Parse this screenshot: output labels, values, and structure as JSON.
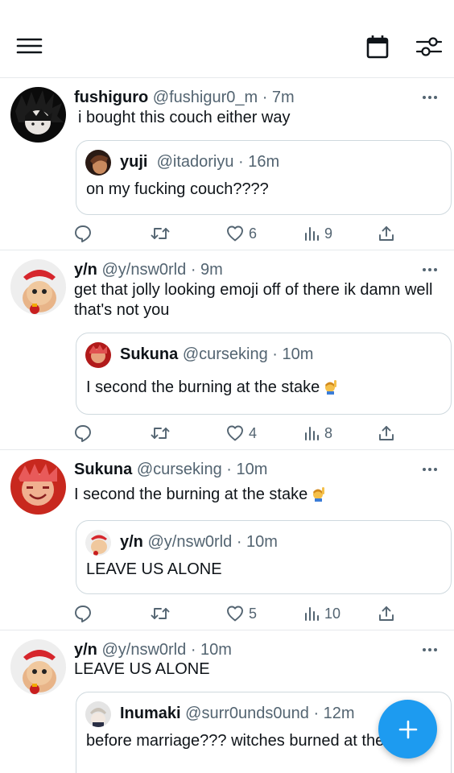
{
  "header": {
    "menu_icon": "hamburger-menu-icon",
    "calendar_icon": "calendar-icon",
    "filter_icon": "sliders-icon"
  },
  "colors": {
    "accent": "#1d9bf0",
    "text": "#0f1419",
    "muted": "#536471",
    "border": "#cfd9de"
  },
  "tweets": [
    {
      "name": "fushiguro",
      "handle": "@fushigur0_m",
      "time": "· 7m",
      "text": "i bought this couch either way",
      "quote": {
        "name": "yuji",
        "handle": "@itadoriyu",
        "time": "· 16m",
        "text": "on my fucking couch????"
      },
      "likes": "6",
      "views": "9"
    },
    {
      "name": "y/n",
      "handle": "@y/nsw0rld",
      "time": "· 9m",
      "text": "get that jolly looking emoji off of there ik damn well that's not you",
      "quote": {
        "name": "Sukuna",
        "handle": "@curseking",
        "time": "· 10m",
        "text": "I second the burning at the stake"
      },
      "likes": "4",
      "views": "8"
    },
    {
      "name": "Sukuna",
      "handle": "@curseking",
      "time": "· 10m",
      "text": "I second the burning at the stake",
      "quote": {
        "name": "y/n",
        "handle": "@y/nsw0rld",
        "time": "· 10m",
        "text": "LEAVE US ALONE"
      },
      "likes": "5",
      "views": "10"
    },
    {
      "name": "y/n",
      "handle": "@y/nsw0rld",
      "time": "· 10m",
      "text": "LEAVE US ALONE",
      "quote": {
        "name": "Inumaki",
        "handle": "@surr0unds0und",
        "time": "· 12m",
        "text": "before marriage??? witches burned at the stake."
      }
    }
  ],
  "fab": {
    "icon": "plus-icon"
  }
}
